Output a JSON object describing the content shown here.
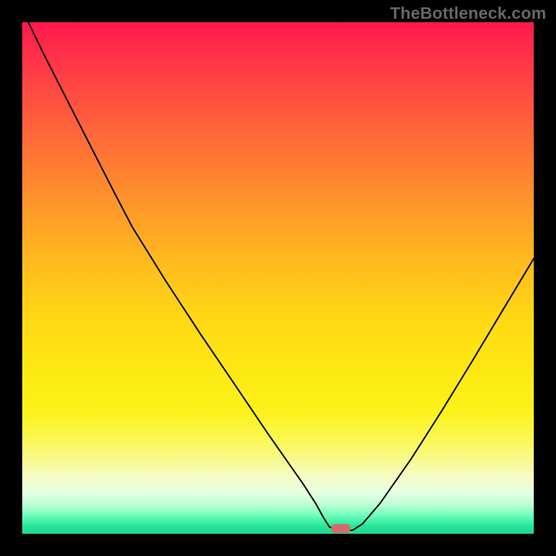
{
  "watermark": "TheBottleneck.com",
  "colors": {
    "frame": "#000000",
    "curve": "#0b0b0b",
    "marker": "#d46a6a",
    "gradient_top": "#ff194d",
    "gradient_mid": "#fde813",
    "gradient_bottom": "#1fd993"
  },
  "chart_data": {
    "type": "line",
    "title": "",
    "xlabel": "",
    "ylabel": "",
    "xlim": [
      0,
      100
    ],
    "ylim": [
      0,
      100
    ],
    "grid": false,
    "legend": null,
    "series": [
      {
        "name": "bottleneck-curve",
        "x": [
          1.2,
          4.0,
          11.0,
          18.0,
          21.5,
          28.0,
          35.0,
          42.0,
          48.0,
          52.0,
          55.0,
          57.5,
          58.8,
          60.0,
          61.5,
          63.0,
          64.6,
          66.5,
          70.0,
          76.0,
          82.0,
          88.0,
          94.0,
          100.0
        ],
        "values": [
          100,
          94.2,
          80.4,
          66.7,
          60.0,
          49.5,
          38.8,
          28.5,
          19.6,
          13.9,
          9.6,
          5.7,
          3.3,
          1.4,
          0.6,
          0.6,
          0.7,
          1.9,
          6.0,
          14.6,
          24.0,
          33.8,
          43.8,
          53.8
        ]
      }
    ],
    "marker": {
      "x": 62.3,
      "y": 0.6,
      "shape": "rounded-rect"
    },
    "flat_interval_x": [
      59.5,
      64.0
    ],
    "annotations": []
  }
}
